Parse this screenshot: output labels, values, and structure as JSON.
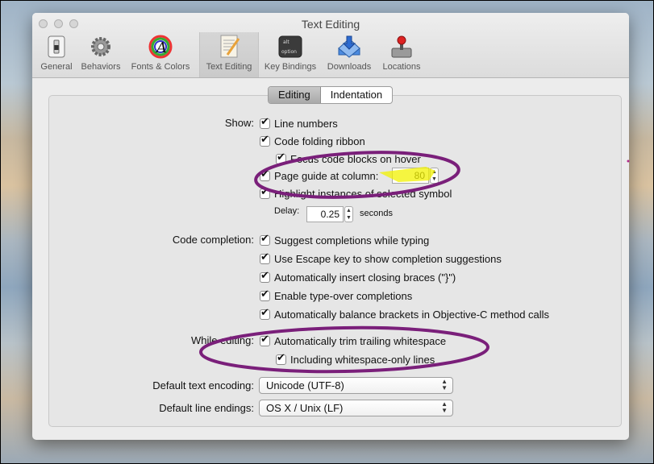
{
  "window": {
    "title": "Text Editing",
    "toolbar": [
      {
        "id": "general",
        "label": "General",
        "icon": "switch-icon"
      },
      {
        "id": "behaviors",
        "label": "Behaviors",
        "icon": "gears-icon"
      },
      {
        "id": "fonts",
        "label": "Fonts & Colors",
        "icon": "font-palette-icon"
      },
      {
        "id": "textediting",
        "label": "Text Editing",
        "icon": "document-pencil-icon",
        "active": true
      },
      {
        "id": "keybindings",
        "label": "Key Bindings",
        "icon": "option-key-icon"
      },
      {
        "id": "downloads",
        "label": "Downloads",
        "icon": "download-box-icon"
      },
      {
        "id": "locations",
        "label": "Locations",
        "icon": "joystick-icon"
      }
    ]
  },
  "tabs": {
    "editing": "Editing",
    "indentation": "Indentation",
    "selected": "Editing"
  },
  "show": {
    "label": "Show:",
    "line_numbers": "Line numbers",
    "code_folding": "Code folding ribbon",
    "focus_code": "Focus code blocks on hover",
    "page_guide": "Page guide at column:",
    "page_guide_value": "80",
    "highlight": "Highlight instances of selected symbol",
    "delay_label": "Delay:",
    "delay_value": "0.25",
    "delay_unit": "seconds"
  },
  "completion": {
    "label": "Code completion:",
    "items": [
      "Suggest completions while typing",
      "Use Escape key to show completion suggestions",
      "Automatically insert closing braces (\"}\")",
      "Enable type-over completions",
      "Automatically balance brackets in Objective-C method calls"
    ]
  },
  "editing": {
    "label": "While editing:",
    "trim": "Automatically trim trailing whitespace",
    "whitespace_only": "Including whitespace-only lines"
  },
  "encoding": {
    "label": "Default text encoding:",
    "value": "Unicode (UTF-8)"
  },
  "line_endings": {
    "label": "Default line endings:",
    "value": "OS X / Unix (LF)"
  },
  "colors": {
    "annotation": "#7a1f7a",
    "highlight": "#f2f200"
  }
}
